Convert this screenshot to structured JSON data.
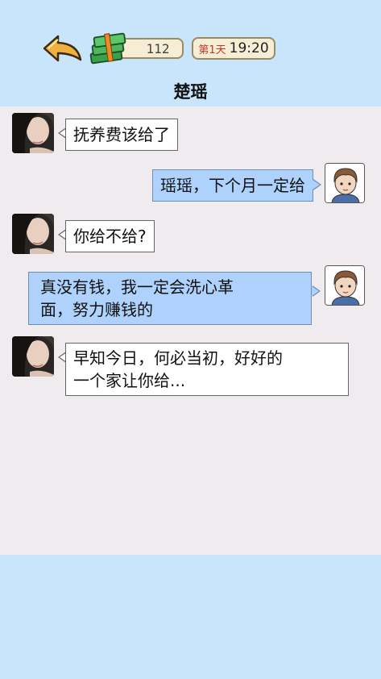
{
  "header": {
    "money_count": "112",
    "day_label": "第1天",
    "clock": "19:20",
    "contact_name": "楚瑶"
  },
  "messages": [
    {
      "sender": "contact",
      "text": "抚养费该给了"
    },
    {
      "sender": "me",
      "text": "瑶瑶，下个月一定给"
    },
    {
      "sender": "contact",
      "text": "你给不给?"
    },
    {
      "sender": "me",
      "lines": [
        "真没有钱，我一定会洗心革",
        "面，努力赚钱的"
      ]
    },
    {
      "sender": "contact",
      "lines": [
        "早知今日，何必当初，好好的",
        "一个家让你给..."
      ]
    }
  ],
  "icons": {
    "back": "back-arrow-icon",
    "money": "cash-stack-icon"
  },
  "colors": {
    "background": "#c9e5fb",
    "chat_background": "#efebef",
    "my_bubble": "#aed2fb",
    "contact_bubble": "#ffffff",
    "back_arrow": "#f0b040",
    "money_green": "#3aa04a"
  }
}
